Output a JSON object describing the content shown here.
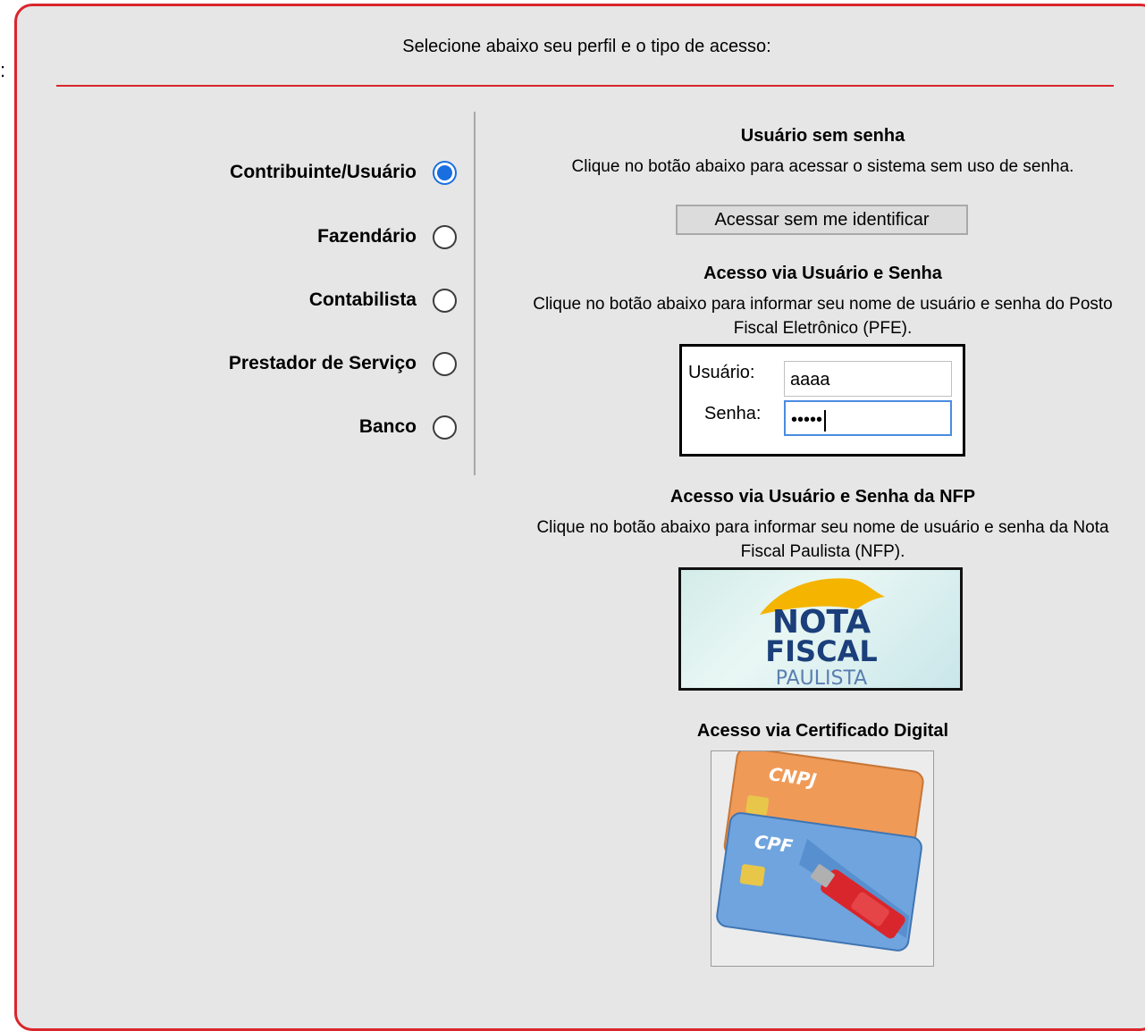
{
  "stray_colon": ":",
  "header": {
    "instruction": "Selecione abaixo seu perfil e o tipo de acesso:"
  },
  "profiles": [
    {
      "label": "Contribuinte/Usuário",
      "selected": true
    },
    {
      "label": "Fazendário",
      "selected": false
    },
    {
      "label": "Contabilista",
      "selected": false
    },
    {
      "label": "Prestador de Serviço",
      "selected": false
    },
    {
      "label": "Banco",
      "selected": false
    }
  ],
  "anon": {
    "title": "Usuário sem senha",
    "description": "Clique no botão abaixo para acessar o sistema sem uso de senha.",
    "button_label": "Acessar sem me identificar"
  },
  "pfe": {
    "title": "Acesso via Usuário e Senha",
    "description": "Clique no botão abaixo para informar seu nome de usuário e senha do Posto Fiscal Eletrônico (PFE).",
    "username_label": "Usuário:",
    "username_value": "aaaa",
    "password_label": "Senha:",
    "password_value": "•••••"
  },
  "nfp": {
    "title": "Acesso via Usuário e Senha da NFP",
    "description": "Clique no botão abaixo para informar seu nome de usuário e senha da Nota Fiscal Paulista (NFP).",
    "logo_line1": "NOTA",
    "logo_line2": "FISCAL",
    "logo_line3": "PAULISTA"
  },
  "cert": {
    "title": "Acesso via Certificado Digital",
    "card1_label": "CNPJ",
    "card2_label": "CPF"
  },
  "colors": {
    "accent_red": "#d9262c",
    "panel_bg": "#e6e6e6",
    "radio_blue": "#1a6fe0",
    "nfp_yellow": "#f4b400",
    "nfp_blue": "#1b3f7a"
  }
}
